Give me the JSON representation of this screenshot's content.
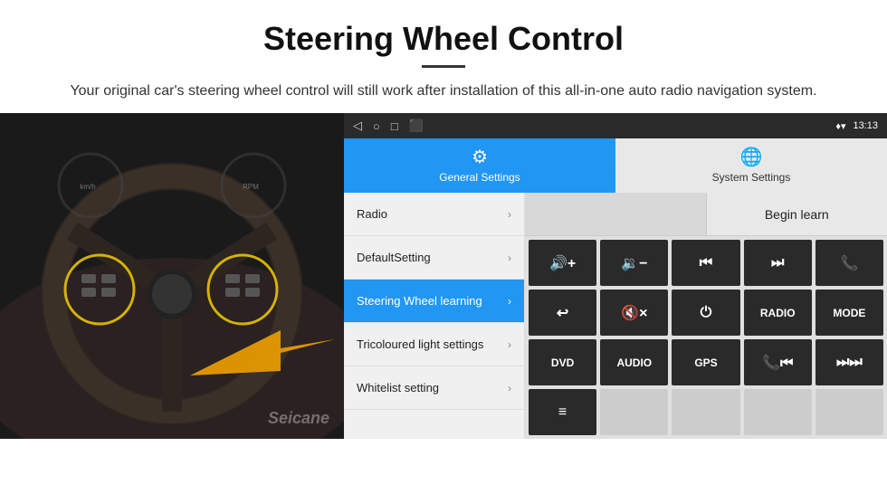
{
  "header": {
    "title": "Steering Wheel Control",
    "subtitle": "Your original car's steering wheel control will still work after installation of this all-in-one auto radio navigation system."
  },
  "status_bar": {
    "icons": [
      "◁",
      "○",
      "□",
      "⬛"
    ],
    "right_icons": "♦ ▾",
    "time": "13:13"
  },
  "tabs": [
    {
      "id": "general",
      "label": "General Settings",
      "icon": "⚙",
      "active": true
    },
    {
      "id": "system",
      "label": "System Settings",
      "icon": "🌐",
      "active": false
    }
  ],
  "menu": [
    {
      "id": "radio",
      "label": "Radio",
      "active": false
    },
    {
      "id": "default",
      "label": "DefaultSetting",
      "active": false
    },
    {
      "id": "steering",
      "label": "Steering Wheel learning",
      "active": true
    },
    {
      "id": "tricoloured",
      "label": "Tricoloured light settings",
      "active": false
    },
    {
      "id": "whitelist",
      "label": "Whitelist setting",
      "active": false
    }
  ],
  "right_panel": {
    "begin_learn_label": "Begin learn",
    "button_rows": [
      [
        {
          "id": "vol-up",
          "label": "🔊+",
          "symbol": true
        },
        {
          "id": "vol-down",
          "label": "🔉-",
          "symbol": true
        },
        {
          "id": "prev-track",
          "label": "⏮",
          "symbol": true
        },
        {
          "id": "next-track",
          "label": "⏭",
          "symbol": true
        },
        {
          "id": "phone",
          "label": "📞",
          "symbol": true
        }
      ],
      [
        {
          "id": "hang-up",
          "label": "↩",
          "symbol": true
        },
        {
          "id": "mute",
          "label": "🔇×",
          "symbol": true
        },
        {
          "id": "power",
          "label": "⏻",
          "symbol": true
        },
        {
          "id": "radio-btn",
          "label": "RADIO",
          "symbol": false
        },
        {
          "id": "mode",
          "label": "MODE",
          "symbol": false
        }
      ],
      [
        {
          "id": "dvd",
          "label": "DVD",
          "symbol": false
        },
        {
          "id": "audio",
          "label": "AUDIO",
          "symbol": false
        },
        {
          "id": "gps",
          "label": "GPS",
          "symbol": false
        },
        {
          "id": "phone2",
          "label": "📞⏮",
          "symbol": true
        },
        {
          "id": "skip",
          "label": "⏭⏭",
          "symbol": true
        }
      ],
      [
        {
          "id": "menu-icon",
          "label": "≡",
          "symbol": true
        },
        {
          "id": "empty1",
          "label": "",
          "symbol": false
        },
        {
          "id": "empty2",
          "label": "",
          "symbol": false
        },
        {
          "id": "empty3",
          "label": "",
          "symbol": false
        },
        {
          "id": "empty4",
          "label": "",
          "symbol": false
        }
      ]
    ]
  },
  "watermark": "Seicane"
}
